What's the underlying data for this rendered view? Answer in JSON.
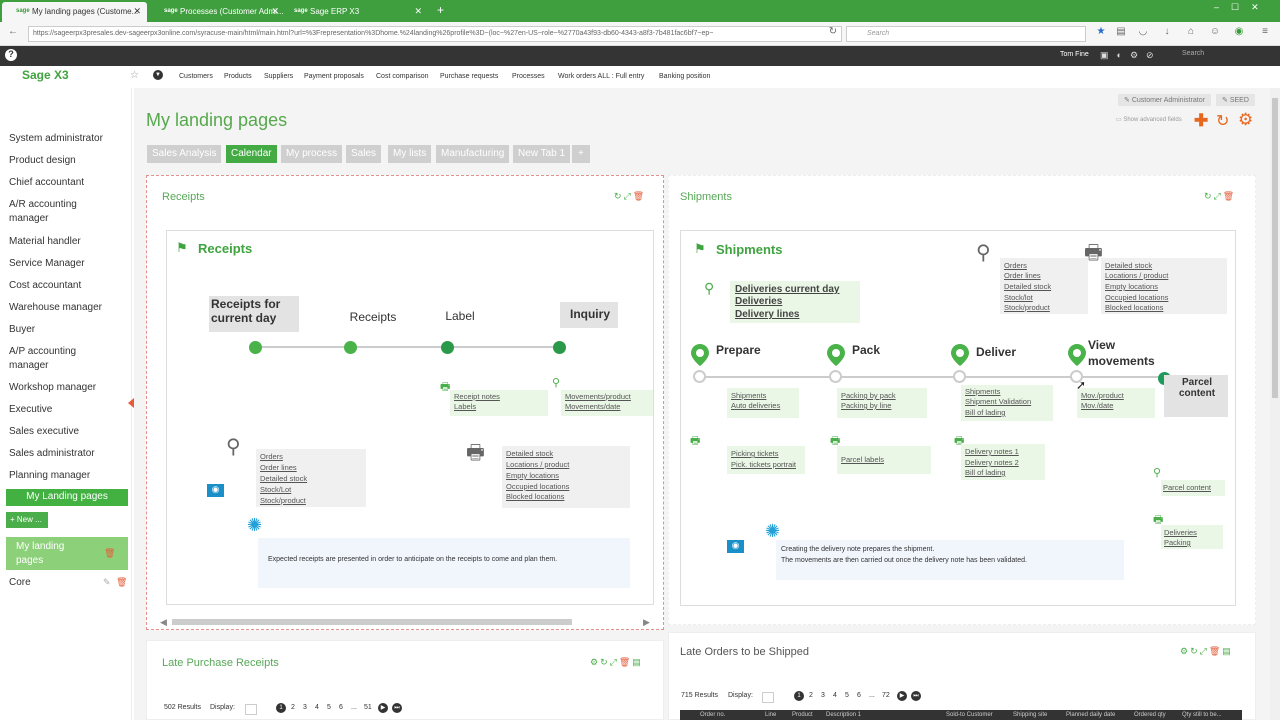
{
  "browser": {
    "tabs": [
      {
        "label": "My landing pages (Custome..."
      },
      {
        "label": "Processes (Customer Admi..."
      },
      {
        "label": "Sage ERP X3"
      }
    ],
    "url": "https://sageerpx3presales.dev-sageerpx3online.com/syracuse-main/html/main.html?url=%3Frepresentation%3Dhome.%24landing%26profile%3D~(loc~%27en-US~role~%2770a43f93-db60-4343-a8f3-7b481fac6bf7~ep~",
    "search_placeholder": "Search"
  },
  "sagebar": {
    "user": "Tom Fine",
    "search": "Search"
  },
  "app": {
    "logo": "Sage X3"
  },
  "topnav": [
    "Customers",
    "Products",
    "Suppliers",
    "Payment proposals",
    "Cost comparison",
    "Purchase requests",
    "Processes",
    "Work orders ALL : Full entry",
    "Banking position"
  ],
  "sidebar": {
    "items": [
      "System administrator",
      "Product design",
      "Chief accountant",
      "A/R accounting manager",
      "Material handler",
      "Service Manager",
      "Cost accountant",
      "Warehouse manager",
      "Buyer",
      "A/P accounting manager",
      "Workshop manager",
      "Executive",
      "Sales executive",
      "Sales administrator",
      "Planning manager"
    ],
    "active": "My Landing pages",
    "new": "+ New ...",
    "landing": "My landing pages",
    "core": "Core"
  },
  "header": {
    "title": "My landing pages",
    "role": "Customer Administrator",
    "seed": "SEED",
    "advanced": "Show advanced fields"
  },
  "page_tabs": [
    "Sales Analysis",
    "Calendar",
    "My process",
    "Sales",
    "My lists",
    "Manufacturing",
    "New Tab 1",
    "+"
  ],
  "receipts": {
    "panel_title": "Receipts",
    "card_title": "Receipts",
    "steps": [
      "Receipts for current day",
      "Receipts",
      "Label",
      "Inquiry"
    ],
    "label_links": [
      "Receipt notes",
      "Labels"
    ],
    "inquiry_links": [
      "Movements/product",
      "Movements/date"
    ],
    "search_links": [
      "Orders",
      "Order lines",
      "Detailed stock",
      "Stock/Lot",
      "Stock/product"
    ],
    "print_links": [
      "Detailed stock",
      "Locations / product",
      "Empty locations",
      "Occupied locations",
      "Blocked locations"
    ],
    "tip": "Expected receipts are presented in order to anticipate on the receipts to come and plan them."
  },
  "shipments": {
    "panel_title": "Shipments",
    "card_title": "Shipments",
    "current_day": [
      "Deliveries current day",
      "Deliveries",
      "Delivery lines"
    ],
    "search_links": [
      "Orders",
      "Order lines",
      "Detailed stock",
      "Stock/lot",
      "Stock/product"
    ],
    "print_links": [
      "Detailed stock",
      "Locations / product",
      "Empty locations",
      "Occupied locations",
      "Blocked locations"
    ],
    "steps": [
      "Prepare",
      "Pack",
      "Deliver",
      "View movements",
      "Parcel content"
    ],
    "prepare_links": [
      "Shipments",
      "Auto deliveries"
    ],
    "pack_links": [
      "Packing by pack",
      "Packing by line"
    ],
    "deliver_links": [
      "Shipments",
      "Shipment Validation",
      "Bill of lading"
    ],
    "view_links": [
      "Mov./product",
      "Mov./date"
    ],
    "prepare_print": [
      "Picking tickets",
      "Pick. tickets portrait"
    ],
    "pack_print": [
      "Parcel labels"
    ],
    "deliver_print": [
      "Delivery notes 1",
      "Delivery notes 2",
      "Bill of lading"
    ],
    "parcel_search": [
      "Parcel content"
    ],
    "parcel_print": [
      "Deliveries",
      "Packing"
    ],
    "tip": [
      "Creating the delivery note prepares the shipment.",
      "The movements are then carried out once the delivery note has been validated."
    ]
  },
  "late_purchase": {
    "title": "Late Purchase Receipts",
    "results": "502 Results",
    "display": "Display:",
    "pages": [
      "1",
      "2",
      "3",
      "4",
      "5",
      "6",
      "...",
      "51"
    ]
  },
  "late_orders": {
    "title": "Late Orders to be Shipped",
    "results": "715 Results",
    "display": "Display:",
    "pages": [
      "1",
      "2",
      "3",
      "4",
      "5",
      "6",
      "...",
      "72"
    ],
    "columns": [
      "Order no.",
      "Line",
      "Product",
      "Description 1",
      "Sold-to Customer",
      "Shipping site",
      "Planned daily date",
      "Ordered qty",
      "Qty still to be..."
    ]
  },
  "colors": {
    "accent": "#44ab44",
    "browser": "#3f9f3f",
    "dark": "#343434"
  }
}
